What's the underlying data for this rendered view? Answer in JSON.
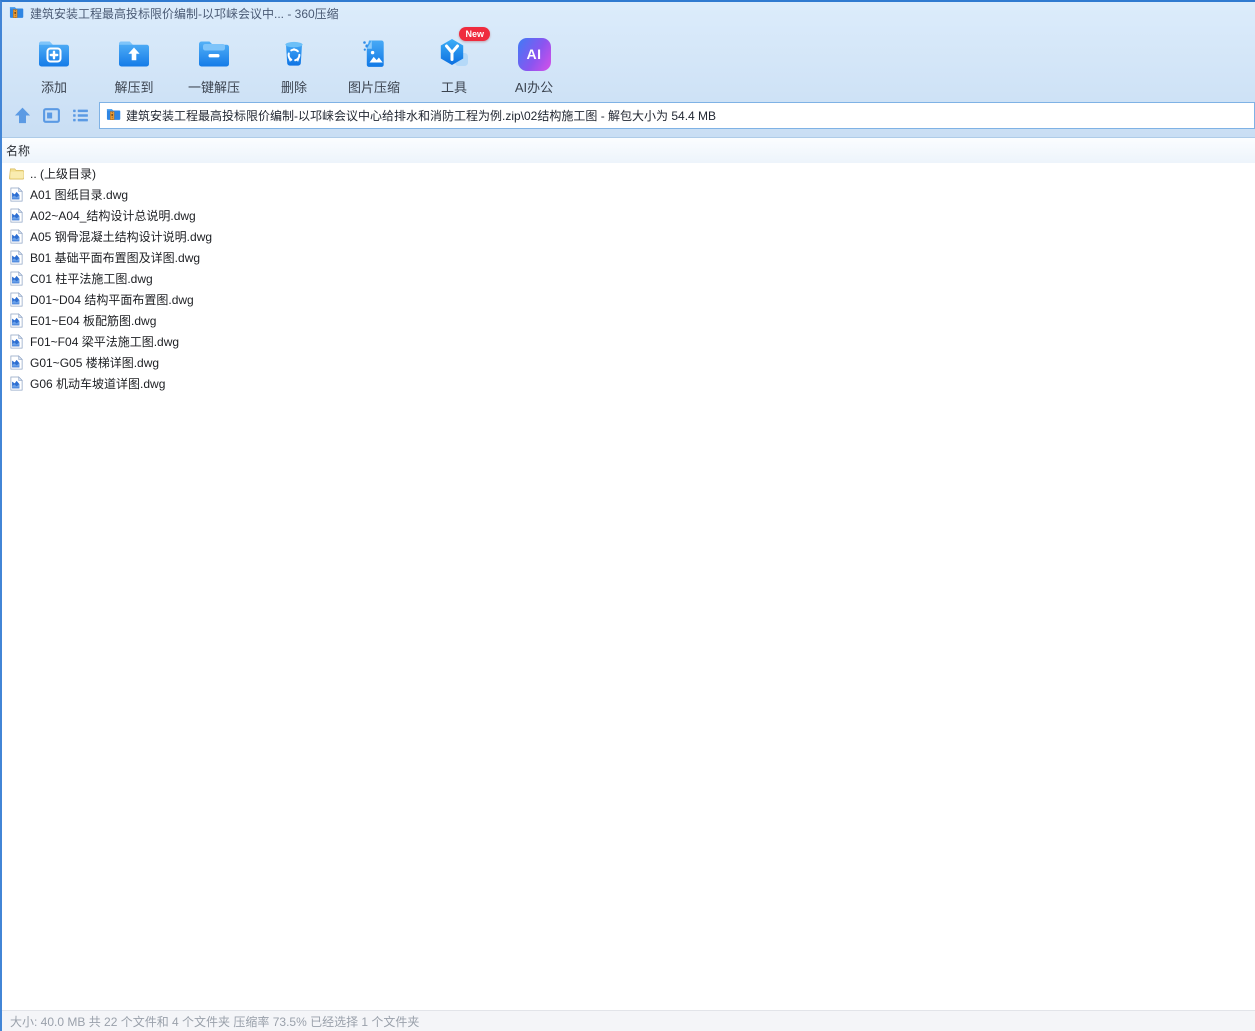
{
  "window": {
    "title": "建筑安装工程最高投标限价编制-以邛崃会议中... - 360压缩"
  },
  "toolbar": {
    "items": [
      {
        "label": "添加",
        "icon": "add-folder-icon"
      },
      {
        "label": "解压到",
        "icon": "extract-to-folder-icon"
      },
      {
        "label": "一键解压",
        "icon": "one-click-extract-folder-icon"
      },
      {
        "label": "删除",
        "icon": "delete-trash-icon"
      },
      {
        "label": "图片压缩",
        "icon": "image-compress-icon"
      },
      {
        "label": "工具",
        "icon": "tools-hexagon-icon",
        "badge": "New"
      },
      {
        "label": "AI办公",
        "icon": "ai-office-icon",
        "icon_text": "AI"
      }
    ]
  },
  "addressbar": {
    "path": "建筑安装工程最高投标限价编制-以邛崃会议中心给排水和消防工程为例.zip\\02结构施工图 - 解包大小为 54.4 MB"
  },
  "list": {
    "columns": [
      {
        "label": "名称"
      }
    ],
    "rows": [
      {
        "name": ".. (上级目录)",
        "icon": "folder-icon"
      },
      {
        "name": "A01 图纸目录.dwg",
        "icon": "dwg-file-icon"
      },
      {
        "name": "A02~A04_结构设计总说明.dwg",
        "icon": "dwg-file-icon"
      },
      {
        "name": "A05 钢骨混凝土结构设计说明.dwg",
        "icon": "dwg-file-icon"
      },
      {
        "name": "B01 基础平面布置图及详图.dwg",
        "icon": "dwg-file-icon"
      },
      {
        "name": "C01 柱平法施工图.dwg",
        "icon": "dwg-file-icon"
      },
      {
        "name": "D01~D04 结构平面布置图.dwg",
        "icon": "dwg-file-icon"
      },
      {
        "name": "E01~E04 板配筋图.dwg",
        "icon": "dwg-file-icon"
      },
      {
        "name": "F01~F04 梁平法施工图.dwg",
        "icon": "dwg-file-icon"
      },
      {
        "name": "G01~G05 楼梯详图.dwg",
        "icon": "dwg-file-icon"
      },
      {
        "name": "G06 机动车坡道详图.dwg",
        "icon": "dwg-file-icon"
      }
    ]
  },
  "statusbar": {
    "text": "大小: 40.0 MB 共 22 个文件和 4 个文件夹 压缩率 73.5% 已经选择 1 个文件夹"
  },
  "colors": {
    "accent_blue": "#2f7ad0",
    "toolbar_icon_blue": "#1a84ee",
    "nav_icon_blue": "#5b9ae4",
    "badge_red": "#ef2b3e",
    "zip_orange": "#f2a33c",
    "status_text": "#9aa1ab"
  }
}
